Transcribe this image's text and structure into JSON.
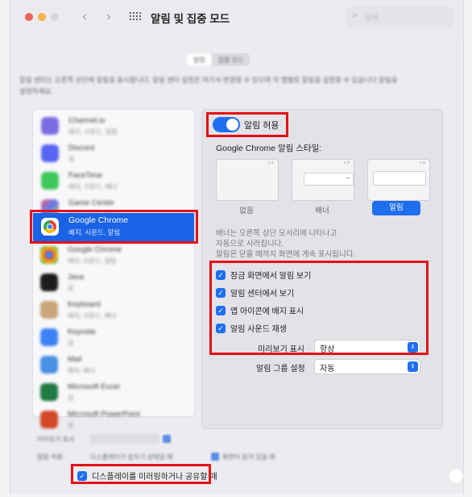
{
  "window": {
    "title": "알림 및 집중 모드"
  },
  "tabs": [
    "알림",
    "집중 모드"
  ],
  "toggle": {
    "label": "알림 허용",
    "on": true
  },
  "style_label": "Google Chrome 알림 스타일:",
  "styles": [
    {
      "name": "없음",
      "selected": false
    },
    {
      "name": "배너",
      "selected": false
    },
    {
      "name": "알림",
      "selected": true
    }
  ],
  "banner_description": "배너는 오른쪽 상단 모서리에 나타나고\n자동으로 사라집니다.\n알림은 닫을 때까지 화면에 계속 표시됩니다.",
  "checkboxes": [
    {
      "label": "잠금 화면에서 알림 보기",
      "checked": true
    },
    {
      "label": "알림 센터에서 보기",
      "checked": true
    },
    {
      "label": "앱 아이콘에 배지 표시",
      "checked": true
    },
    {
      "label": "알림 사운드 재생",
      "checked": true
    }
  ],
  "preview": {
    "label": "미리보기 표시",
    "value": "항상"
  },
  "grouping": {
    "label": "알림 그룹 설정",
    "value": "자동"
  },
  "sidebar": {
    "selected": {
      "name": "Google Chrome",
      "subtitle": "배지, 사운드, 알림"
    }
  },
  "bottom_checkbox": {
    "label": "디스플레이를 미러링하거나 공유할 때",
    "checked": true
  },
  "colors": {
    "accent": "#1e6ff0",
    "highlight": "#e40f16",
    "selection": "#1a63e6"
  }
}
